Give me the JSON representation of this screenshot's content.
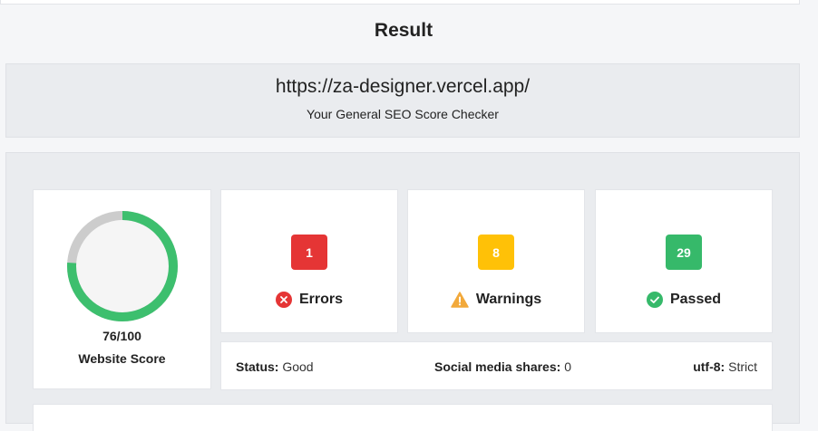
{
  "page": {
    "title": "Result",
    "url": "https://za-designer.vercel.app/",
    "subtitle": "Your General SEO Score Checker"
  },
  "score": {
    "value": 76,
    "max": 100,
    "display": "76/100",
    "label": "Website Score",
    "ring_color": "#3dbf6e",
    "track_color": "#cccccc"
  },
  "stats": [
    {
      "label": "Errors",
      "count": "1",
      "color": "#e53535",
      "icon": "error-x-icon"
    },
    {
      "label": "Warnings",
      "count": "8",
      "color": "#ffc107",
      "icon": "warning-triangle-icon"
    },
    {
      "label": "Passed",
      "count": "29",
      "color": "#36b96a",
      "icon": "check-circle-icon"
    }
  ],
  "info": {
    "status_key": "Status:",
    "status_value": "Good",
    "social_key": "Social media shares:",
    "social_value": "0",
    "charset_key": "utf-8:",
    "charset_value": "Strict"
  }
}
